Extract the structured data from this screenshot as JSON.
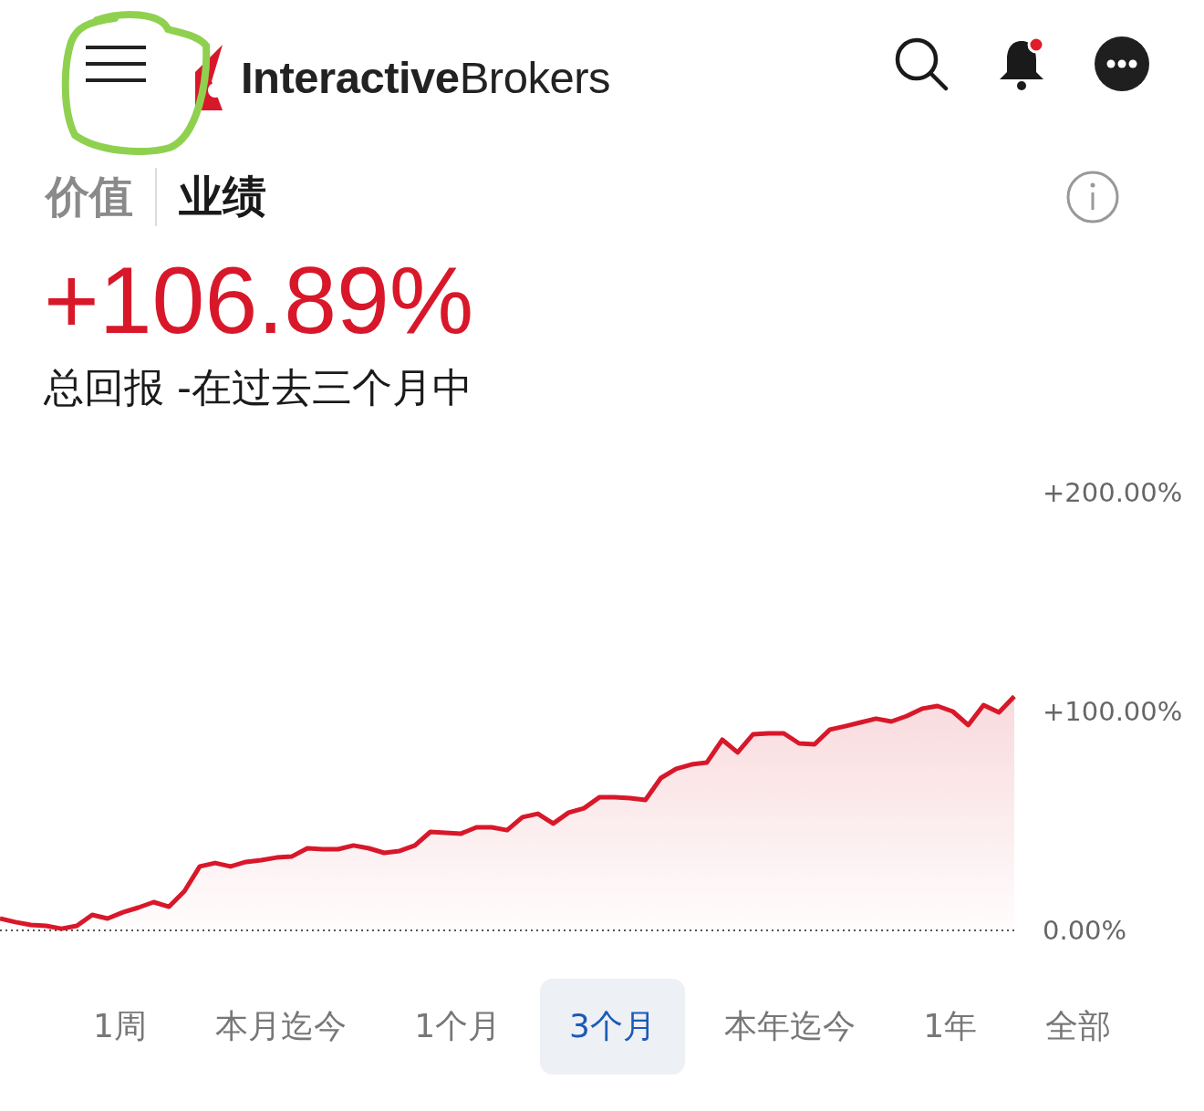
{
  "header": {
    "logo": "**Interactive**Brokers"
  },
  "view_tabs": [
    {
      "label": "价值",
      "selected": false
    },
    {
      "label": "业绩",
      "selected": true
    }
  ],
  "total_return": {
    "value": "+106.89%",
    "caption": "总回报 -在过去三个月中"
  },
  "chart": {
    "chart_data": {
      "type": "area",
      "ylim": [
        0,
        200
      ],
      "yticks": [
        {
          "value": 0,
          "label": "0.00%"
        },
        {
          "value": 100,
          "label": "+100.00%"
        },
        {
          "value": 200,
          "label": "+200.00%"
        }
      ],
      "series": [
        {
          "color": "#d8182a",
          "values": [
            5.4,
            3.8,
            2.5,
            2.1,
            0.8,
            2.1,
            7.1,
            5.4,
            8.3,
            10.4,
            12.9,
            10.8,
            17.9,
            29.2,
            30.8,
            29.2,
            31.3,
            32.1,
            33.3,
            33.8,
            37.5,
            37.1,
            37.1,
            38.8,
            37.5,
            35.4,
            36.3,
            38.8,
            45.0,
            44.6,
            44.2,
            47.1,
            47.1,
            45.8,
            51.7,
            53.3,
            48.8,
            53.8,
            55.8,
            60.8,
            60.8,
            60.4,
            59.6,
            69.6,
            73.8,
            75.8,
            76.7,
            87.1,
            81.3,
            89.6,
            90.0,
            90.0,
            85.4,
            85.0,
            91.7,
            93.3,
            95.0,
            96.7,
            95.4,
            97.9,
            101.3,
            102.5,
            100.0,
            93.8,
            102.9,
            99.6,
            106.9
          ]
        }
      ]
    }
  },
  "periods": [
    {
      "label": "1周",
      "selected": false
    },
    {
      "label": "本月迄今",
      "selected": false
    },
    {
      "label": "1个月",
      "selected": false
    },
    {
      "label": "3个月",
      "selected": true
    },
    {
      "label": "本年迄今",
      "selected": false
    },
    {
      "label": "1年",
      "selected": false
    },
    {
      "label": "全部",
      "selected": false
    }
  ]
}
